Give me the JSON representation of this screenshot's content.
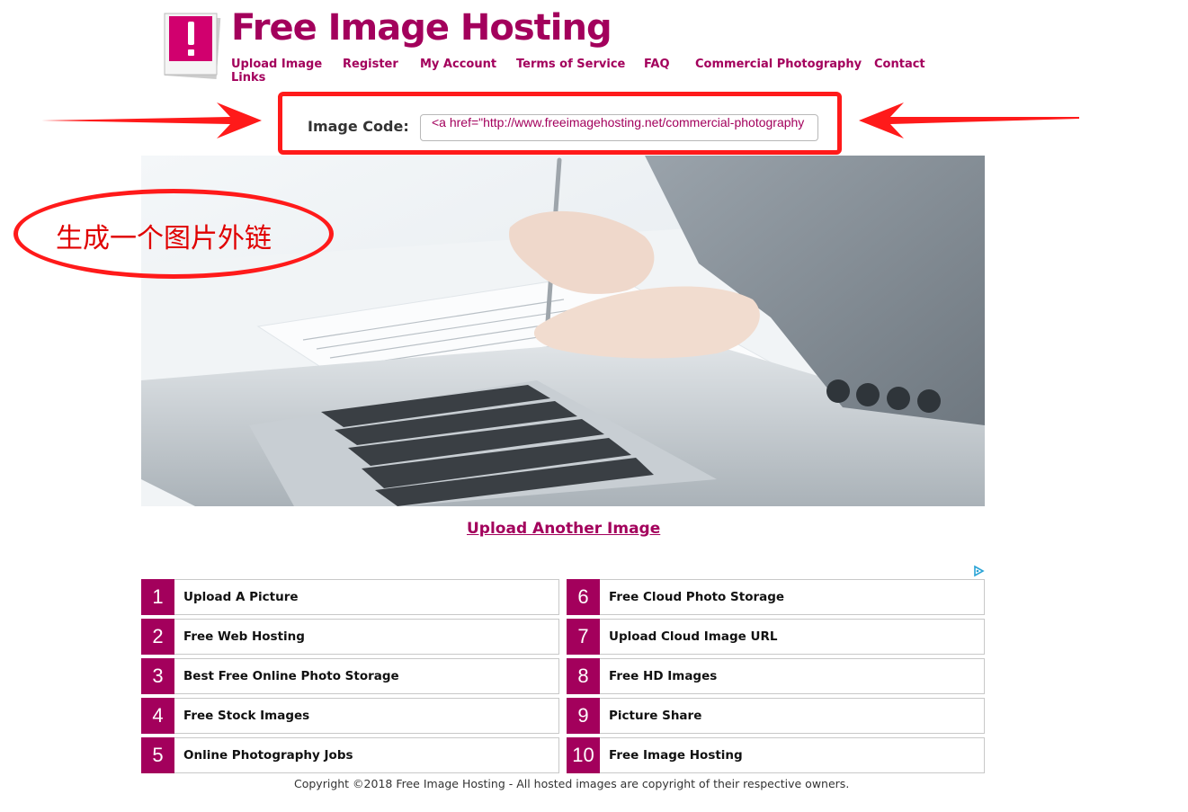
{
  "header": {
    "title": "Free Image Hosting",
    "nav": [
      "Upload Image Links",
      "Register",
      "My Account",
      "Terms of Service",
      "FAQ",
      "Commercial Photography",
      "Contact"
    ]
  },
  "image_code": {
    "label": "Image Code:",
    "value": "<a href=\"http://www.freeimagehosting.net/commercial-photography"
  },
  "annotation": {
    "text": "生成一个图片外链"
  },
  "upload_another": "Upload Another Image",
  "links_left": [
    {
      "num": "1",
      "label": "Upload A Picture"
    },
    {
      "num": "2",
      "label": "Free Web Hosting"
    },
    {
      "num": "3",
      "label": "Best Free Online Photo Storage"
    },
    {
      "num": "4",
      "label": "Free Stock Images"
    },
    {
      "num": "5",
      "label": "Online Photography Jobs"
    }
  ],
  "links_right": [
    {
      "num": "6",
      "label": "Free Cloud Photo Storage"
    },
    {
      "num": "7",
      "label": "Upload Cloud Image URL"
    },
    {
      "num": "8",
      "label": "Free HD Images"
    },
    {
      "num": "9",
      "label": "Picture Share"
    },
    {
      "num": "10",
      "label": "Free Image Hosting"
    }
  ],
  "footer": "Copyright ©2018 Free Image Hosting - All hosted images are copyright of their respective owners.",
  "colors": {
    "brand": "#a3005c",
    "annotation": "#ff1a1a"
  },
  "icons": [
    "logo-icon",
    "adchoices-icon"
  ]
}
